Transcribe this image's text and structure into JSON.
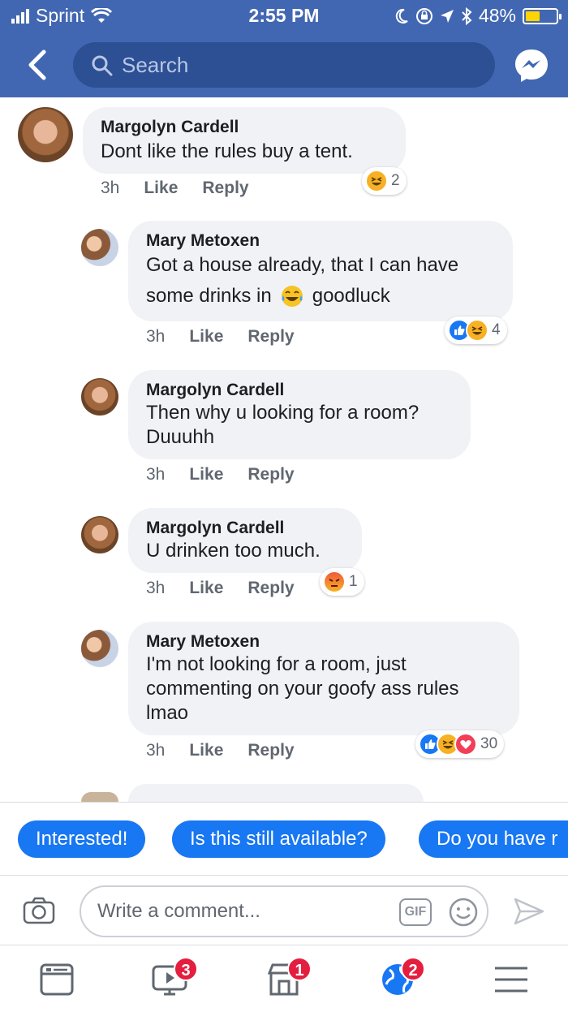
{
  "status_bar": {
    "carrier": "Sprint",
    "time": "2:55 PM",
    "battery_percent": "48%",
    "battery_level": 0.48,
    "icons": [
      "signal-icon",
      "wifi-icon",
      "moon-icon",
      "rotation-lock-icon",
      "location-arrow-icon",
      "bluetooth-icon",
      "battery-icon"
    ]
  },
  "header": {
    "search_placeholder": "Search",
    "accent_color": "#4267b2",
    "icons": [
      "back-chevron-icon",
      "search-icon",
      "messenger-icon"
    ]
  },
  "comments": [
    {
      "author": "Margolyn Cardell",
      "text": "Dont like the rules buy a tent.",
      "time": "3h",
      "like": "Like",
      "reply": "Reply",
      "reactions": [
        "haha"
      ],
      "reaction_count": "2"
    },
    {
      "author": "Mary Metoxen",
      "text_line1": "Got a house already, that I can have",
      "text_line2_a": "some drinks in",
      "text_line2_b": "goodluck",
      "emoji": "tears-of-joy-emoji",
      "time": "3h",
      "like": "Like",
      "reply": "Reply",
      "reactions": [
        "like",
        "haha"
      ],
      "reaction_count": "4"
    },
    {
      "author": "Margolyn Cardell",
      "text_line1": "Then why u looking for a room?",
      "text_line2": "Duuuhh",
      "time": "3h",
      "like": "Like",
      "reply": "Reply"
    },
    {
      "author": "Margolyn Cardell",
      "text": "U drinken too much.",
      "time": "3h",
      "like": "Like",
      "reply": "Reply",
      "reactions": [
        "angry"
      ],
      "reaction_count": "1"
    },
    {
      "author": "Mary Metoxen",
      "text_line1": "I'm not looking for a room, just",
      "text_line2": "commenting on your goofy ass rules",
      "text_line3": "lmao",
      "time": "3h",
      "like": "Like",
      "reply": "Reply",
      "reactions": [
        "like",
        "haha",
        "love"
      ],
      "reaction_count": "30"
    }
  ],
  "quick_replies": [
    "Interested!",
    "Is this still available?",
    "Do you have r"
  ],
  "composer": {
    "placeholder": "Write a comment...",
    "gif_label": "GIF",
    "icons": [
      "camera-icon",
      "smiley-icon",
      "send-icon"
    ]
  },
  "tab_bar": {
    "tabs": [
      {
        "name": "news-feed",
        "badge": null
      },
      {
        "name": "watch",
        "badge": "3"
      },
      {
        "name": "marketplace",
        "badge": "1"
      },
      {
        "name": "notifications",
        "badge": "2"
      },
      {
        "name": "menu",
        "badge": null
      }
    ]
  }
}
